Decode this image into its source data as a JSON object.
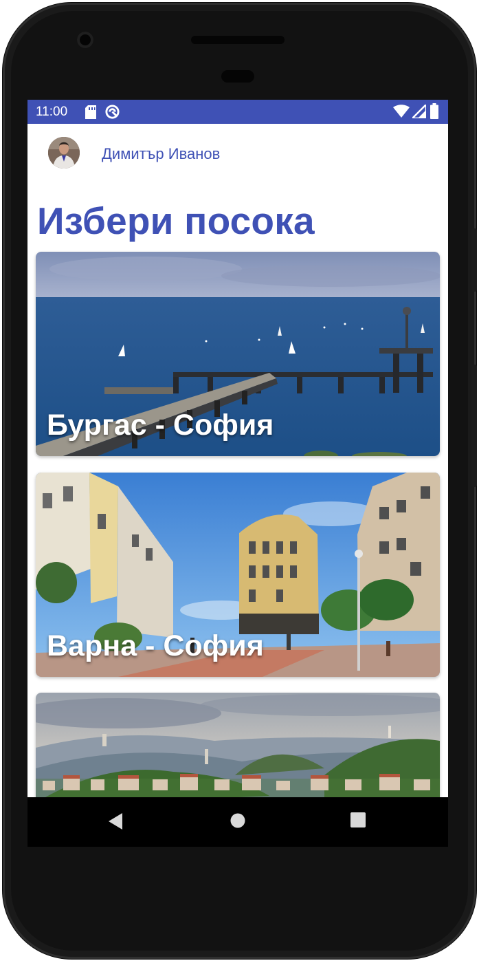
{
  "status_bar": {
    "time": "11:00",
    "color": "#3f51b5",
    "left_icons": [
      "sd-card-icon",
      "sync-icon"
    ],
    "right_icons": [
      "wifi-icon",
      "signal-icon",
      "battery-icon"
    ]
  },
  "profile": {
    "name": "Димитър Иванов",
    "avatar_icon": "user-avatar"
  },
  "title": "Избери посока",
  "accent_color": "#3f51b5",
  "routes": [
    {
      "label": "Бургас - София",
      "image": "pier-sea-photo"
    },
    {
      "label": "Варна - София",
      "image": "city-street-photo"
    },
    {
      "label": "",
      "image": "hills-city-photo"
    }
  ],
  "nav_bar": {
    "buttons": [
      "back-icon",
      "home-icon",
      "recents-icon"
    ]
  }
}
